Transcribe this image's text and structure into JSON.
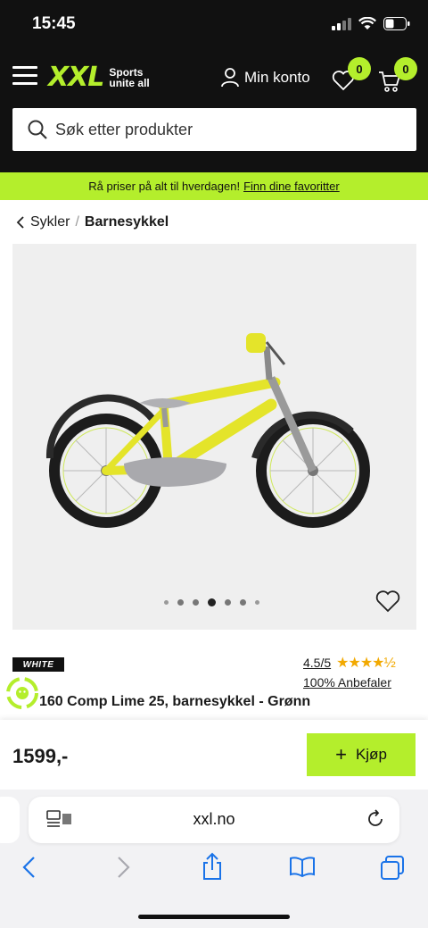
{
  "status": {
    "time": "15:45"
  },
  "header": {
    "logo_text": "XXL",
    "tagline_1": "Sports",
    "tagline_2": "unite all",
    "account_label": "Min konto",
    "wishlist_count": "0",
    "cart_count": "0",
    "search_placeholder": "Søk etter produkter"
  },
  "promo": {
    "text": "Rå priser på alt til hverdagen!",
    "link": "Finn dine favoritter"
  },
  "breadcrumb": {
    "parent": "Sykler",
    "separator": "/",
    "current": "Barnesykkel"
  },
  "product": {
    "brand": "WHITE",
    "rating": "4.5/5",
    "stars": "★★★★½",
    "recommend": "100% Anbefaler",
    "title": "160 Comp Lime 25, barnesykkel - Grønn",
    "price": "1599,-",
    "buy_label": "Kjøp",
    "gallery_active_index": 3,
    "gallery_count": 7
  },
  "browser": {
    "url": "xxl.no"
  },
  "colors": {
    "brand_green": "#b4ee2c",
    "header_bg": "#111111",
    "star": "#f2a900",
    "ios_blue": "#1a73e8"
  }
}
